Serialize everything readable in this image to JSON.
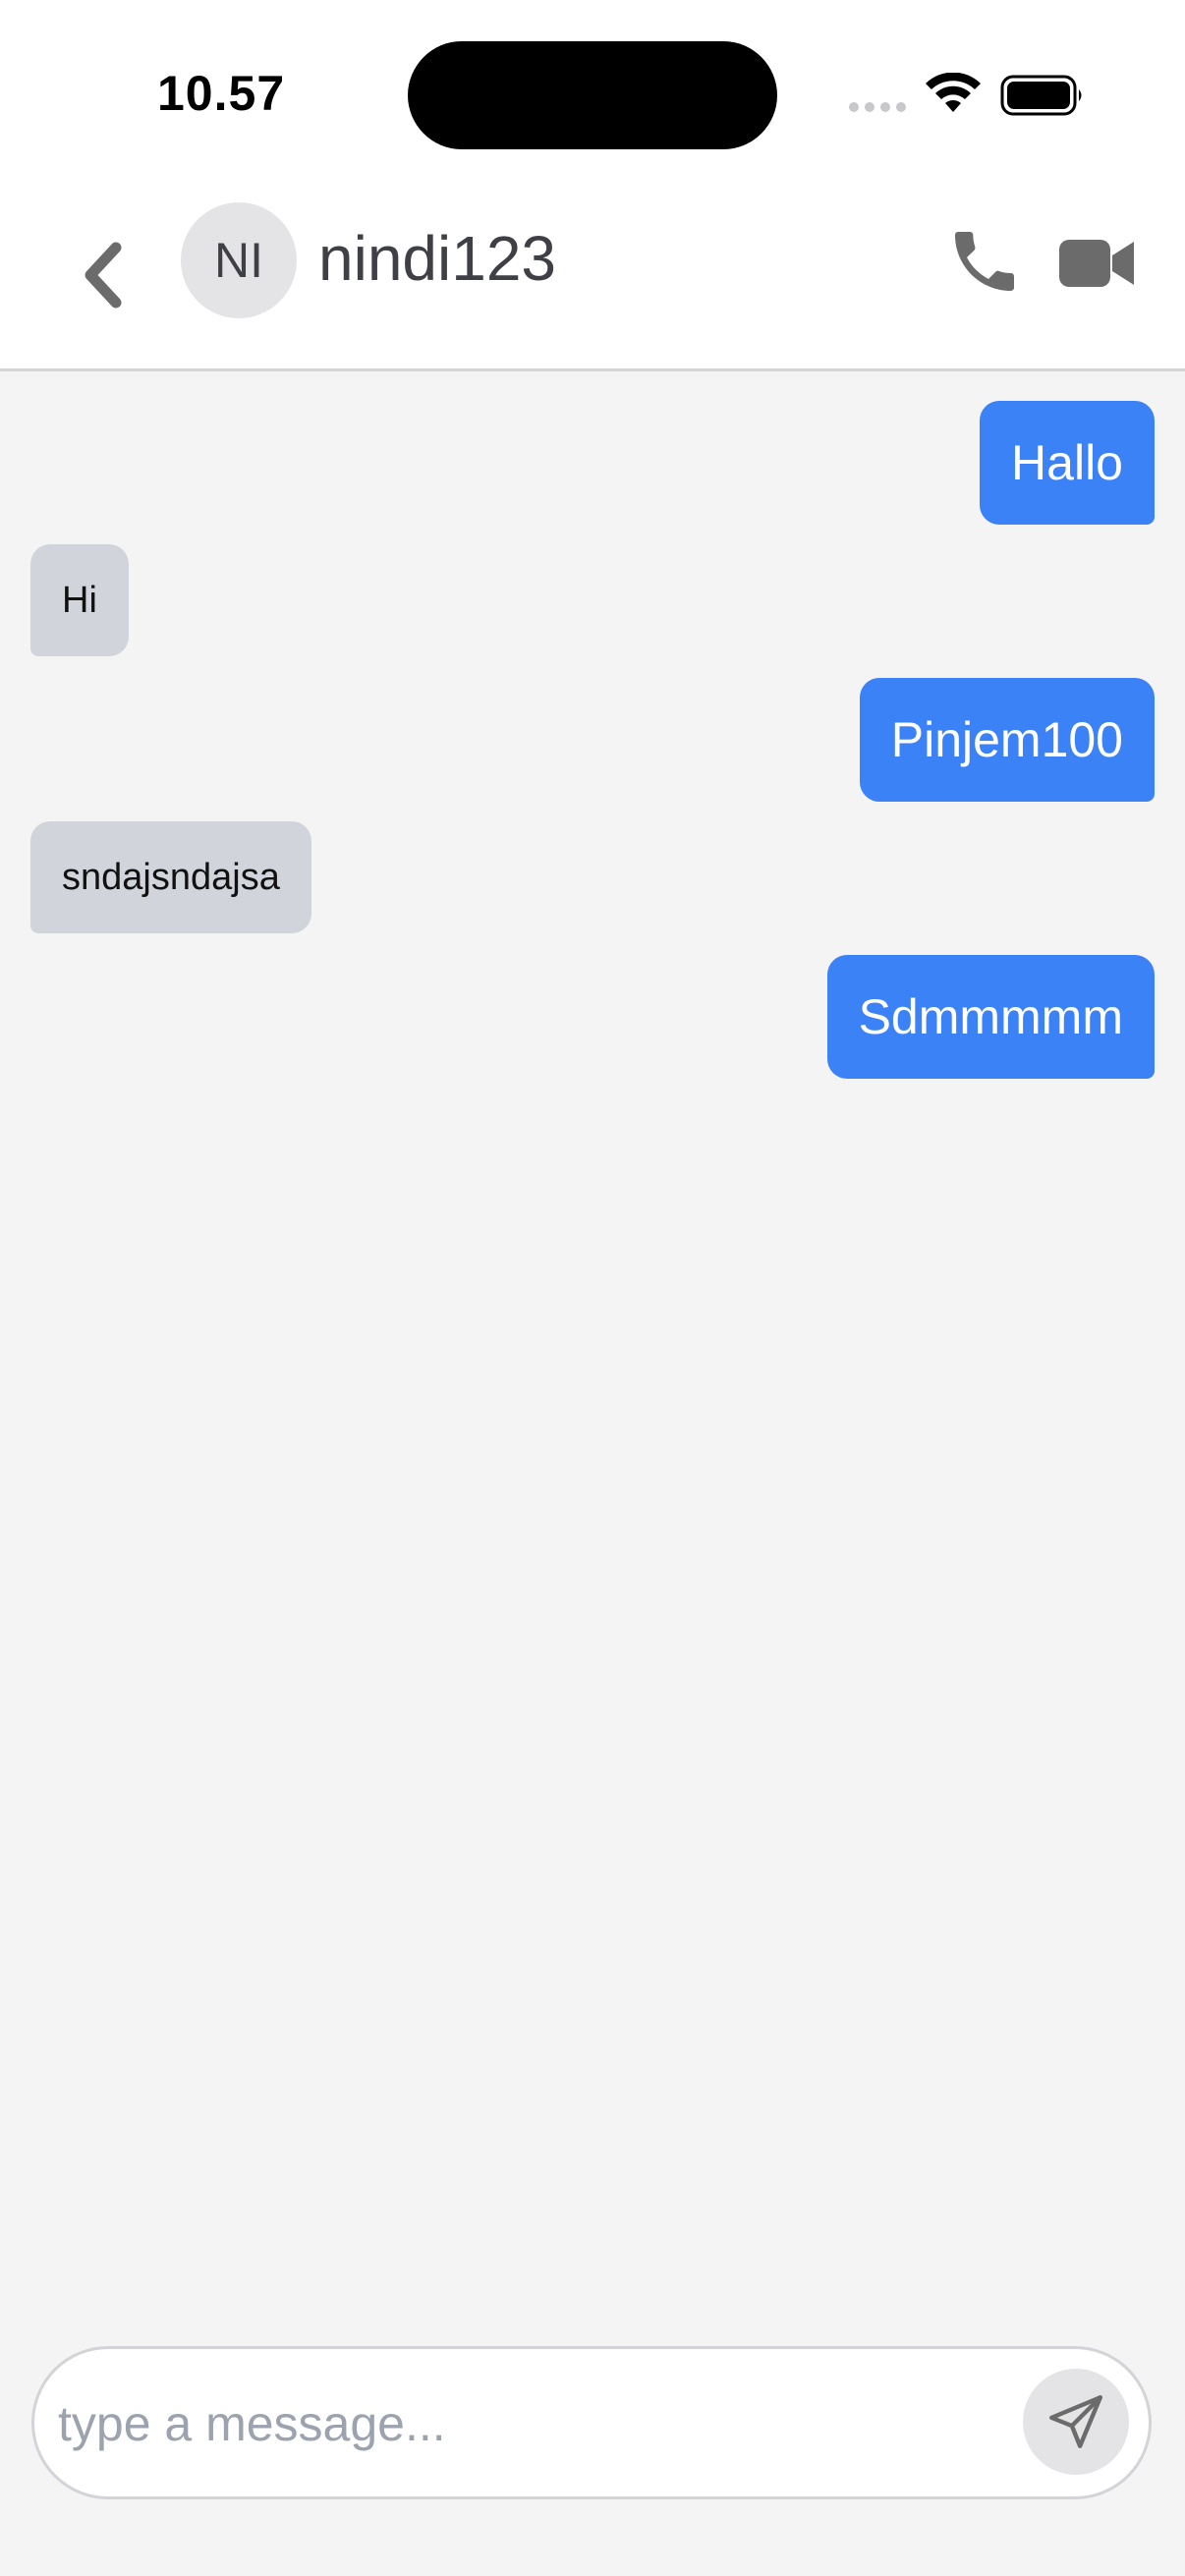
{
  "status_bar": {
    "time": "10.57"
  },
  "header": {
    "avatar_initials": "NI",
    "contact_name": "nindi123",
    "icons": {
      "back": "chevron-left-icon",
      "call": "phone-icon",
      "video": "video-camera-icon"
    }
  },
  "messages": [
    {
      "direction": "sent",
      "text": "Hallo"
    },
    {
      "direction": "received",
      "text": "Hi"
    },
    {
      "direction": "sent",
      "text": "Pinjem100"
    },
    {
      "direction": "received",
      "text": "sndajsndajsa"
    },
    {
      "direction": "sent",
      "text": "Sdmmmmm"
    }
  ],
  "composer": {
    "placeholder": "type a message...",
    "value": "",
    "send_icon": "send-icon"
  },
  "colors": {
    "sent_bubble": "#3b82f6",
    "received_bubble": "#d1d5db",
    "background": "#f4f4f5"
  }
}
